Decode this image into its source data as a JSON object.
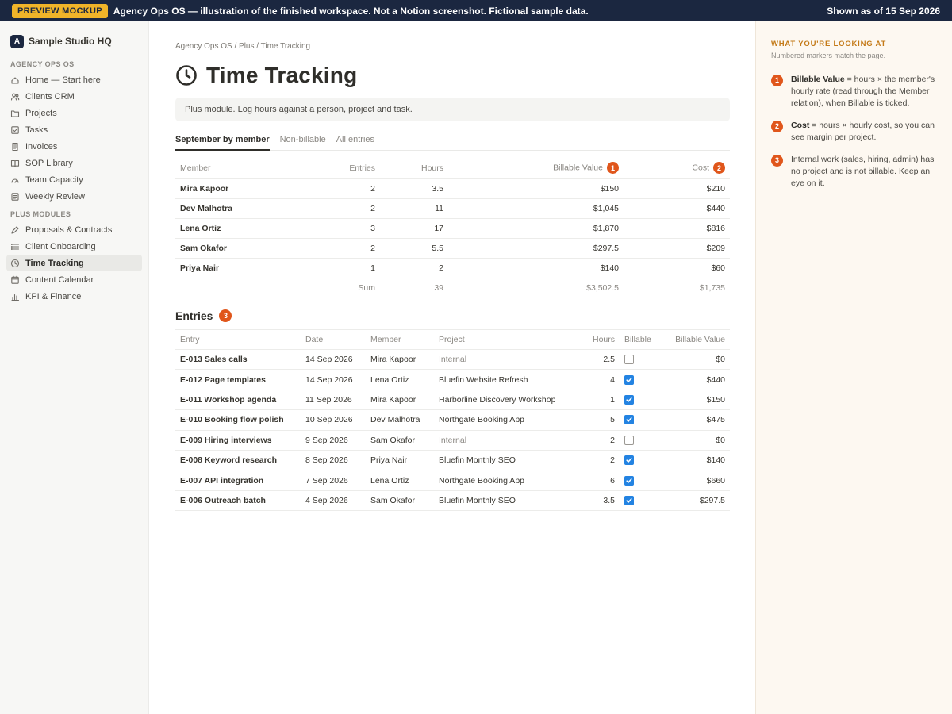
{
  "banner": {
    "badge": "PREVIEW MOCKUP",
    "text": "Agency Ops OS — illustration of the finished workspace. Not a Notion screenshot. Fictional sample data.",
    "date": "Shown as of 15 Sep 2026"
  },
  "sidebar": {
    "logo_letter": "A",
    "workspace": "Sample Studio HQ",
    "section1_label": "AGENCY OPS OS",
    "section1_items": [
      {
        "label": "Home — Start here",
        "icon": "home-icon"
      },
      {
        "label": "Clients CRM",
        "icon": "people-icon"
      },
      {
        "label": "Projects",
        "icon": "folder-icon"
      },
      {
        "label": "Tasks",
        "icon": "checkbox-icon"
      },
      {
        "label": "Invoices",
        "icon": "receipt-icon"
      },
      {
        "label": "SOP Library",
        "icon": "book-icon"
      },
      {
        "label": "Team Capacity",
        "icon": "gauge-icon"
      },
      {
        "label": "Weekly Review",
        "icon": "calendar-note-icon"
      }
    ],
    "section2_label": "PLUS MODULES",
    "section2_items": [
      {
        "label": "Proposals & Contracts",
        "icon": "pen-icon"
      },
      {
        "label": "Client Onboarding",
        "icon": "list-icon"
      },
      {
        "label": "Time Tracking",
        "icon": "clock-icon",
        "active": true
      },
      {
        "label": "Content Calendar",
        "icon": "calendar-icon"
      },
      {
        "label": "KPI & Finance",
        "icon": "bar-chart-icon"
      }
    ]
  },
  "main": {
    "breadcrumb": "Agency Ops OS / Plus / Time Tracking",
    "title": "Time Tracking",
    "callout": "Plus module. Log hours against a person, project and task.",
    "tabs": [
      "September by member",
      "Non-billable",
      "All entries"
    ],
    "members_table": {
      "headers": [
        "Member",
        "Entries",
        "Hours",
        "Billable Value",
        "Cost"
      ],
      "marker_billable": "1",
      "marker_cost": "2",
      "rows": [
        [
          "Mira Kapoor",
          "2",
          "3.5",
          "$150",
          "$210"
        ],
        [
          "Dev Malhotra",
          "2",
          "11",
          "$1,045",
          "$440"
        ],
        [
          "Lena Ortiz",
          "3",
          "17",
          "$1,870",
          "$816"
        ],
        [
          "Sam Okafor",
          "2",
          "5.5",
          "$297.5",
          "$209"
        ],
        [
          "Priya Nair",
          "1",
          "2",
          "$140",
          "$60"
        ]
      ],
      "sum": {
        "label": "Sum",
        "hours": "39",
        "billable": "$3,502.5",
        "cost": "$1,735"
      }
    },
    "entries_title": "Entries",
    "entries_marker": "3",
    "entries_table": {
      "headers": [
        "Entry",
        "Date",
        "Member",
        "Project",
        "Hours",
        "Billable",
        "Billable Value"
      ],
      "rows": [
        {
          "entry": "E-013 Sales calls",
          "date": "14 Sep 2026",
          "member": "Mira Kapoor",
          "project": "Internal",
          "hours": "2.5",
          "billable": false,
          "value": "$0"
        },
        {
          "entry": "E-012 Page templates",
          "date": "14 Sep 2026",
          "member": "Lena Ortiz",
          "project": "Bluefin Website Refresh",
          "hours": "4",
          "billable": true,
          "value": "$440"
        },
        {
          "entry": "E-011 Workshop agenda",
          "date": "11 Sep 2026",
          "member": "Mira Kapoor",
          "project": "Harborline Discovery Workshop",
          "hours": "1",
          "billable": true,
          "value": "$150"
        },
        {
          "entry": "E-010 Booking flow polish",
          "date": "10 Sep 2026",
          "member": "Dev Malhotra",
          "project": "Northgate Booking App",
          "hours": "5",
          "billable": true,
          "value": "$475"
        },
        {
          "entry": "E-009 Hiring interviews",
          "date": "9 Sep 2026",
          "member": "Sam Okafor",
          "project": "Internal",
          "hours": "2",
          "billable": false,
          "value": "$0"
        },
        {
          "entry": "E-008 Keyword research",
          "date": "8 Sep 2026",
          "member": "Priya Nair",
          "project": "Bluefin Monthly SEO",
          "hours": "2",
          "billable": true,
          "value": "$140"
        },
        {
          "entry": "E-007 API integration",
          "date": "7 Sep 2026",
          "member": "Lena Ortiz",
          "project": "Northgate Booking App",
          "hours": "6",
          "billable": true,
          "value": "$660"
        },
        {
          "entry": "E-006 Outreach batch",
          "date": "4 Sep 2026",
          "member": "Sam Okafor",
          "project": "Bluefin Monthly SEO",
          "hours": "3.5",
          "billable": true,
          "value": "$297.5"
        }
      ]
    }
  },
  "panel": {
    "title": "WHAT YOU'RE LOOKING AT",
    "subtitle": "Numbered markers match the page.",
    "notes": [
      {
        "num": "1",
        "bold": "Billable Value",
        "text": " = hours × the member's hourly rate (read through the Member relation), when Billable is ticked."
      },
      {
        "num": "2",
        "bold": "Cost",
        "text": " = hours × hourly cost, so you can see margin per project."
      },
      {
        "num": "3",
        "bold": "",
        "text": "Internal work (sales, hiring, admin) has no project and is not billable. Keep an eye on it."
      }
    ]
  },
  "colors": {
    "banner_bg": "#1b2740",
    "badge": "#f0b429",
    "marker": "#e0561b",
    "checkbox_on": "#2383e2",
    "panel_bg": "#fdf8f1",
    "panel_title": "#c47a18"
  }
}
